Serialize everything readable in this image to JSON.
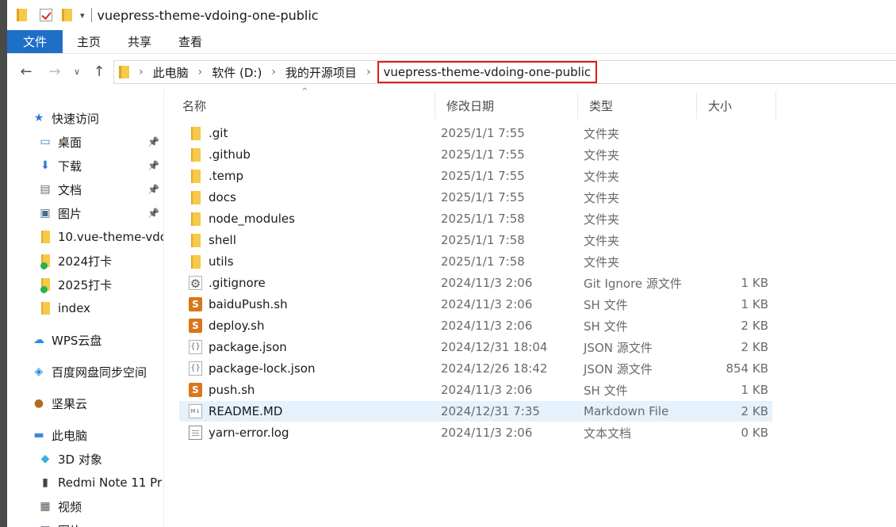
{
  "window": {
    "title": "vuepress-theme-vdoing-one-public"
  },
  "ribbon": {
    "tabs": [
      "文件",
      "主页",
      "共享",
      "查看"
    ]
  },
  "address": {
    "crumbs": [
      "此电脑",
      "软件 (D:)",
      "我的开源项目"
    ],
    "current": "vuepress-theme-vdoing-one-public"
  },
  "navpane": {
    "items": [
      {
        "label": "快速访问",
        "icon": "star-icon",
        "indent": 1
      },
      {
        "label": "桌面",
        "icon": "desktop-icon",
        "indent": 2,
        "pinned": true
      },
      {
        "label": "下载",
        "icon": "download-icon",
        "indent": 2,
        "pinned": true
      },
      {
        "label": "文档",
        "icon": "document-icon",
        "indent": 2,
        "pinned": true
      },
      {
        "label": "图片",
        "icon": "picture-icon",
        "indent": 2,
        "pinned": true
      },
      {
        "label": "10.vue-theme-vdc",
        "icon": "folder-icon",
        "indent": 2
      },
      {
        "label": "2024打卡",
        "icon": "folder-synced-icon",
        "indent": 2
      },
      {
        "label": "2025打卡",
        "icon": "folder-synced-icon",
        "indent": 2
      },
      {
        "label": "index",
        "icon": "folder-icon",
        "indent": 2
      },
      {
        "label": "WPS云盘",
        "icon": "cloud-icon",
        "indent": 1
      },
      {
        "label": "百度网盘同步空间",
        "icon": "baidu-sync-icon",
        "indent": 1
      },
      {
        "label": "坚果云",
        "icon": "nut-icon",
        "indent": 1
      },
      {
        "label": "此电脑",
        "icon": "computer-icon",
        "indent": 1
      },
      {
        "label": "3D 对象",
        "icon": "3d-objects-icon",
        "indent": 2
      },
      {
        "label": "Redmi Note 11 Pr",
        "icon": "phone-icon",
        "indent": 2
      },
      {
        "label": "视频",
        "icon": "video-icon",
        "indent": 2
      },
      {
        "label": "图片",
        "icon": "picture-icon",
        "indent": 2
      }
    ]
  },
  "columns": {
    "name": "名称",
    "date": "修改日期",
    "type": "类型",
    "size": "大小"
  },
  "files": [
    {
      "name": ".git",
      "date": "2025/1/1 7:55",
      "type": "文件夹",
      "size": "",
      "icon": "folder"
    },
    {
      "name": ".github",
      "date": "2025/1/1 7:55",
      "type": "文件夹",
      "size": "",
      "icon": "folder"
    },
    {
      "name": ".temp",
      "date": "2025/1/1 7:55",
      "type": "文件夹",
      "size": "",
      "icon": "folder"
    },
    {
      "name": "docs",
      "date": "2025/1/1 7:55",
      "type": "文件夹",
      "size": "",
      "icon": "folder"
    },
    {
      "name": "node_modules",
      "date": "2025/1/1 7:58",
      "type": "文件夹",
      "size": "",
      "icon": "folder"
    },
    {
      "name": "shell",
      "date": "2025/1/1 7:58",
      "type": "文件夹",
      "size": "",
      "icon": "folder"
    },
    {
      "name": "utils",
      "date": "2025/1/1 7:58",
      "type": "文件夹",
      "size": "",
      "icon": "folder"
    },
    {
      "name": ".gitignore",
      "date": "2024/11/3 2:06",
      "type": "Git Ignore 源文件",
      "size": "1 KB",
      "icon": "gear"
    },
    {
      "name": "baiduPush.sh",
      "date": "2024/11/3 2:06",
      "type": "SH 文件",
      "size": "1 KB",
      "icon": "sh"
    },
    {
      "name": "deploy.sh",
      "date": "2024/11/3 2:06",
      "type": "SH 文件",
      "size": "2 KB",
      "icon": "sh"
    },
    {
      "name": "package.json",
      "date": "2024/12/31 18:04",
      "type": "JSON 源文件",
      "size": "2 KB",
      "icon": "json"
    },
    {
      "name": "package-lock.json",
      "date": "2024/12/26 18:42",
      "type": "JSON 源文件",
      "size": "854 KB",
      "icon": "json"
    },
    {
      "name": "push.sh",
      "date": "2024/11/3 2:06",
      "type": "SH 文件",
      "size": "1 KB",
      "icon": "sh"
    },
    {
      "name": "README.MD",
      "date": "2024/12/31 7:35",
      "type": "Markdown File",
      "size": "2 KB",
      "icon": "md",
      "selected": true
    },
    {
      "name": "yarn-error.log",
      "date": "2024/11/3 2:06",
      "type": "文本文档",
      "size": "0 KB",
      "icon": "doc"
    }
  ],
  "colors": {
    "accent": "#1e6fc8",
    "highlight_border": "#e0191c",
    "selected_row": "#e5f1fb"
  }
}
